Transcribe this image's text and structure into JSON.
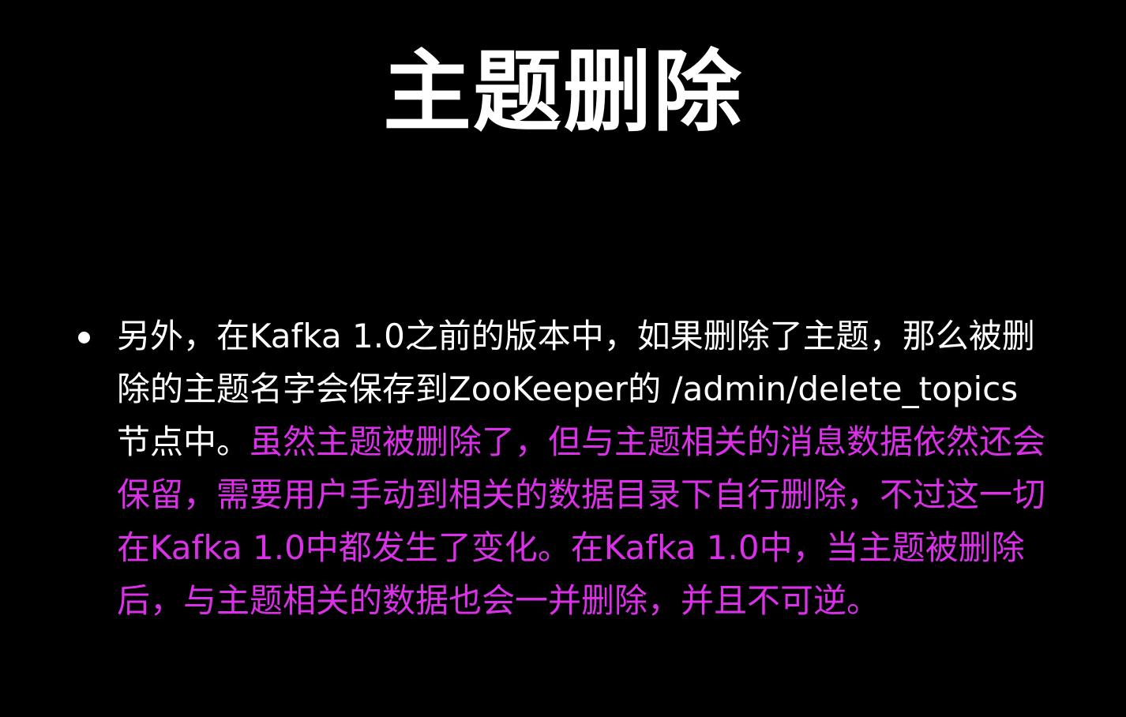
{
  "slide": {
    "title": "主题删除",
    "bullets": [
      {
        "normal_text": "另外，在Kafka 1.0之前的版本中，如果删除了主题，那么被删除的主题名字会保存到ZooKeeper的 /admin/delete_topics 节点中。",
        "highlight_text": "虽然主题被删除了，但与主题相关的消息数据依然还会保留，需要用户手动到相关的数据目录下自行删除，不过这一切在Kafka 1.0中都发生了变化。在Kafka 1.0中，当主题被删除后，与主题相关的数据也会一并删除，并且不可逆。"
      }
    ]
  },
  "colors": {
    "background": "#000000",
    "text": "#ffffff",
    "highlight": "#d930e8"
  }
}
